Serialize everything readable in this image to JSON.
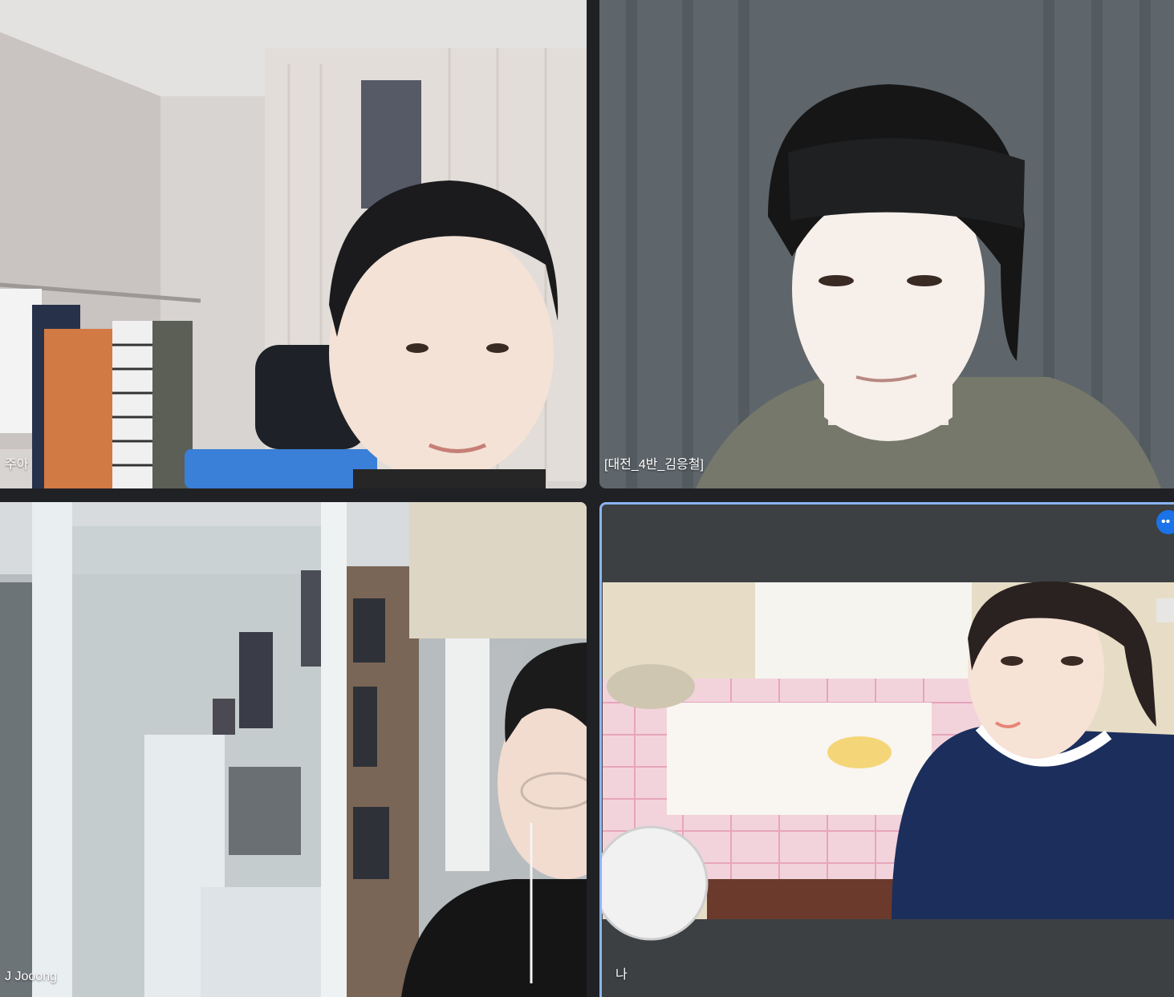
{
  "participants": [
    {
      "name": "주아"
    },
    {
      "name": "[대전_4반_김응철]"
    },
    {
      "name": "J Jooong"
    },
    {
      "name": "나",
      "more_icon": "more-options-icon",
      "more_label": "••"
    }
  ],
  "colors": {
    "background": "#202124",
    "tile": "#3c4043",
    "active_border": "#8ab4f8",
    "accent": "#1a73e8"
  }
}
